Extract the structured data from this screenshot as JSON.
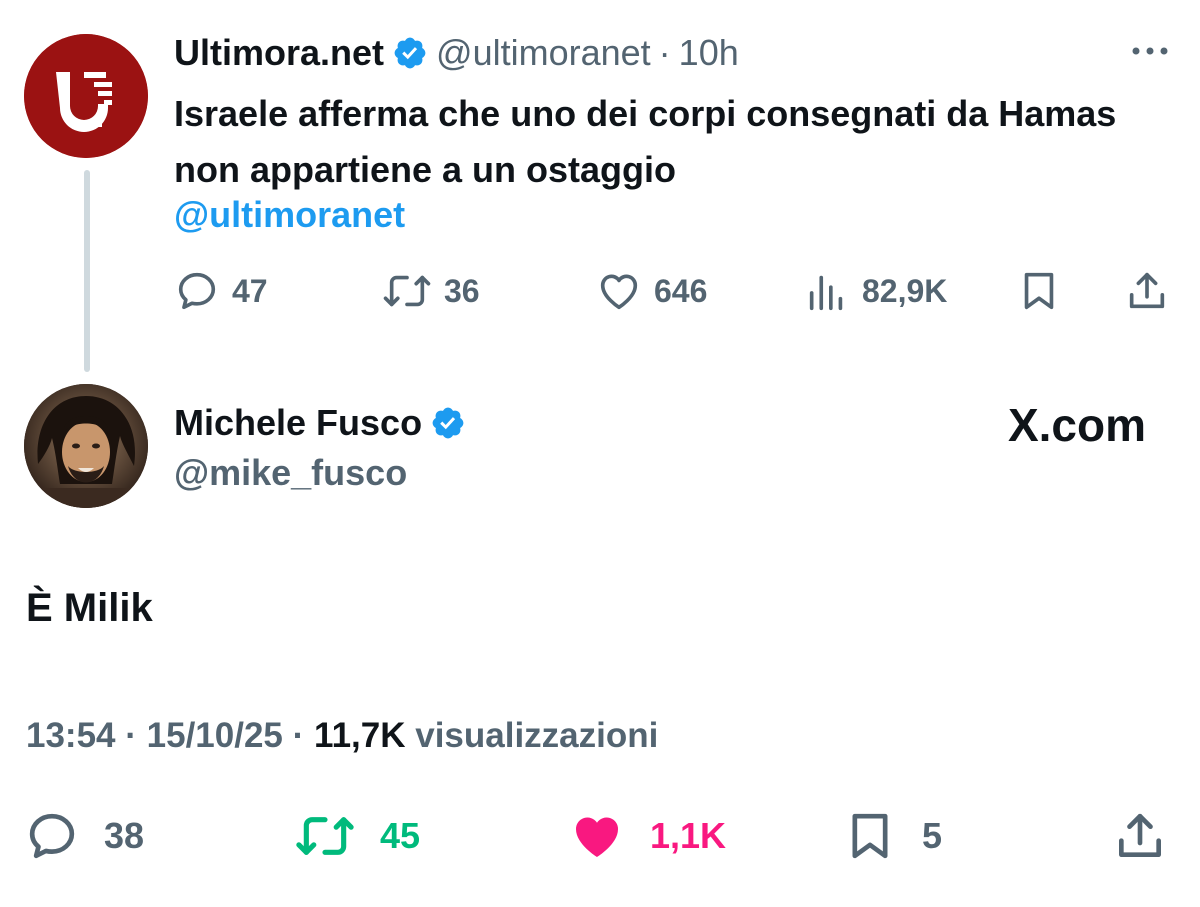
{
  "parent_tweet": {
    "author_name": "Ultimora.net",
    "handle": "@ultimoranet",
    "separator": "·",
    "time": "10h",
    "text": "Israele afferma che uno dei corpi consegnati da Hamas non appartiene a un ostaggio",
    "mention": "@ultimoranet",
    "actions": {
      "replies": "47",
      "reposts": "36",
      "likes": "646",
      "views": "82,9K"
    }
  },
  "main_tweet": {
    "author_name": "Michele Fusco",
    "handle": "@mike_fusco",
    "watermark": "X.com",
    "text": "È Milik",
    "time": "13:54",
    "date": "15/10/25",
    "separator": "·",
    "views_count": "11,7K",
    "views_label": "visualizzazioni",
    "actions": {
      "replies": "38",
      "reposts": "45",
      "likes": "1,1K",
      "bookmarks": "5"
    }
  },
  "colors": {
    "accent_blue": "#1d9bf0",
    "repost_green": "#00ba7c",
    "like_pink": "#f91880",
    "muted_gray": "#536471",
    "text_dark": "#0f1419",
    "avatar_red": "#9b1212"
  },
  "icons": [
    "verified-badge-icon",
    "more-icon",
    "reply-icon",
    "repost-icon",
    "like-icon",
    "views-icon",
    "bookmark-icon",
    "share-icon"
  ]
}
